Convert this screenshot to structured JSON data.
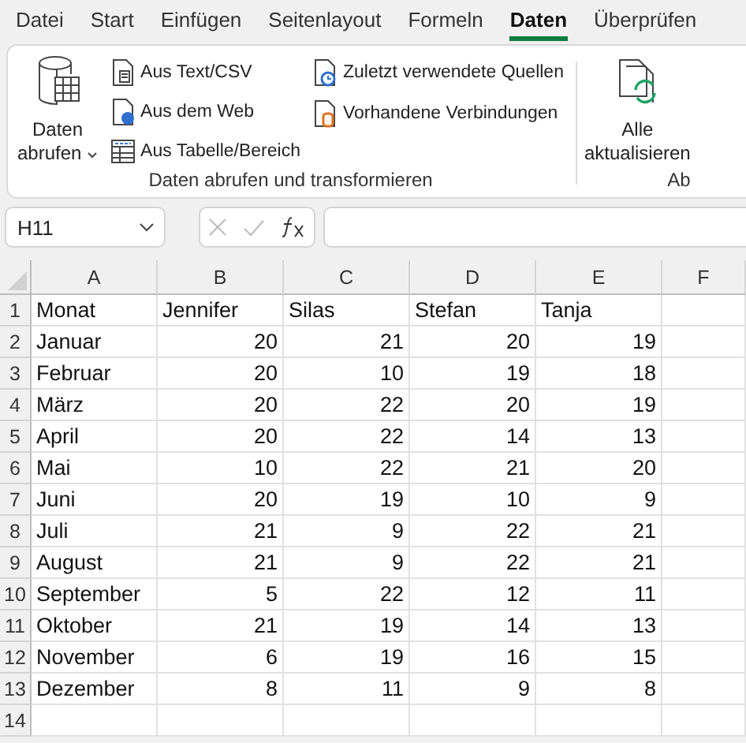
{
  "tabs": [
    {
      "label": "Datei",
      "selected": false
    },
    {
      "label": "Start",
      "selected": false
    },
    {
      "label": "Einfügen",
      "selected": false
    },
    {
      "label": "Seitenlayout",
      "selected": false
    },
    {
      "label": "Formeln",
      "selected": false
    },
    {
      "label": "Daten",
      "selected": true
    },
    {
      "label": "Überprüfen",
      "selected": false
    }
  ],
  "ribbon": {
    "get_data": {
      "line1": "Daten",
      "line2": "abrufen"
    },
    "commands_col1": [
      "Aus Text/CSV",
      "Aus dem Web",
      "Aus Tabelle/Bereich"
    ],
    "commands_col2": [
      "Zuletzt verwendete Quellen",
      "Vorhandene Verbindungen"
    ],
    "group_label": "Daten abrufen und transformieren",
    "refresh_all": {
      "line1": "Alle",
      "line2": "aktualisieren"
    },
    "next_group_label": "Ab"
  },
  "formula_bar": {
    "name_box": "H11"
  },
  "sheet": {
    "columns": [
      "A",
      "B",
      "C",
      "D",
      "E",
      "F"
    ],
    "header_row": {
      "number": "1",
      "cells": [
        "Monat",
        "Jennifer",
        "Silas",
        "Stefan",
        "Tanja"
      ]
    },
    "rows": [
      {
        "number": "2",
        "month": "Januar",
        "values": [
          "20",
          "21",
          "20",
          "19"
        ]
      },
      {
        "number": "3",
        "month": "Februar",
        "values": [
          "20",
          "10",
          "19",
          "18"
        ]
      },
      {
        "number": "4",
        "month": "März",
        "values": [
          "20",
          "22",
          "20",
          "19"
        ]
      },
      {
        "number": "5",
        "month": "April",
        "values": [
          "20",
          "22",
          "14",
          "13"
        ]
      },
      {
        "number": "6",
        "month": "Mai",
        "values": [
          "10",
          "22",
          "21",
          "20"
        ]
      },
      {
        "number": "7",
        "month": "Juni",
        "values": [
          "20",
          "19",
          "10",
          "9"
        ]
      },
      {
        "number": "8",
        "month": "Juli",
        "values": [
          "21",
          "9",
          "22",
          "21"
        ]
      },
      {
        "number": "9",
        "month": "August",
        "values": [
          "21",
          "9",
          "22",
          "21"
        ]
      },
      {
        "number": "10",
        "month": "September",
        "values": [
          "5",
          "22",
          "12",
          "11"
        ]
      },
      {
        "number": "11",
        "month": "Oktober",
        "values": [
          "21",
          "19",
          "14",
          "13"
        ]
      },
      {
        "number": "12",
        "month": "November",
        "values": [
          "6",
          "19",
          "16",
          "15"
        ]
      },
      {
        "number": "13",
        "month": "Dezember",
        "values": [
          "8",
          "11",
          "9",
          "8"
        ]
      },
      {
        "number": "14"
      }
    ]
  }
}
